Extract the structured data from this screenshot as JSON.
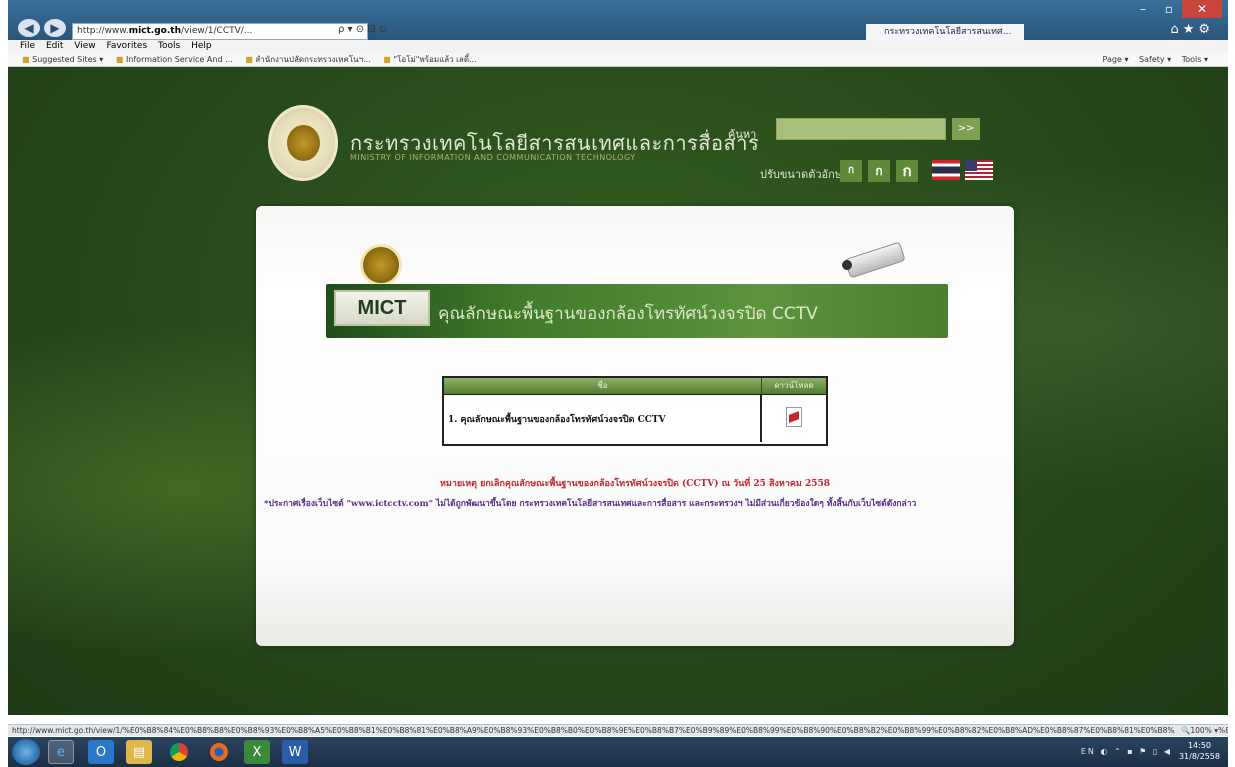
{
  "browser": {
    "address": {
      "prefix": "http://www.",
      "domain": "mict.go.th",
      "path": "/view/1/CCTV/..."
    },
    "tabs": [
      {
        "label": "",
        "active": false
      },
      {
        "label": "",
        "active": false
      },
      {
        "label": "กระทรวงเทคโนโลยีสารสนเทศ...",
        "active": true
      }
    ],
    "menu": [
      "File",
      "Edit",
      "View",
      "Favorites",
      "Tools",
      "Help"
    ],
    "favorites": [
      "Suggested Sites ▾",
      "Information Service And ...",
      "สำนักงานปลัดกระทรวงเทคโนฯ...",
      "\"โอโม่\"พร้อมแล้ว เลดี้..."
    ],
    "command_bar": [
      "Page ▾",
      "Safety ▾",
      "Tools ▾"
    ]
  },
  "site": {
    "title": "กระทรวงเทคโนโลยีสารสนเทศและการสื่อสาร",
    "subtitle": "MINISTRY OF INFORMATION AND COMMUNICATION TECHNOLOGY",
    "search_label": "ค้นหา",
    "search_button": ">>",
    "font_size_label": "ปรับขนาดตัวอักษร",
    "font_buttons": [
      "ก",
      "ก",
      "ก"
    ]
  },
  "banner": {
    "logo_text": "MICT",
    "title": "คุณลักษณะพื้นฐานของกล้องโทรทัศน์วงจรปิด CCTV"
  },
  "table": {
    "header_name": "ชื่อ",
    "header_file": "ดาวน์โหลด",
    "rows": [
      {
        "name": "1. คุณลักษณะพื้นฐานของกล้องโทรทัศน์วงจรปิด CCTV"
      }
    ]
  },
  "notice": "หมายเหตุ ยกเลิกคุณลักษณะพื้นฐานของกล้องโทรทัศน์วงจรปิด (CCTV) ณ วันที่ 25 สิงหาคม 2558",
  "disclaimer": "*ประกาศเรื่องเว็บไซต์ \"www.ictcctv.com\" ไม่ได้ถูกพัฒนาขึ้นโดย กระทรวงเทคโนโลยีสารสนเทศและการสื่อสาร และกระทรวงฯ ไม่มีส่วนเกี่ยวข้องใดๆ ทั้งสิ้นกับเว็บไซต์ดังกล่าว",
  "status": {
    "url": "http://www.mict.go.th/view/1/%E0%B8%84%E0%B8%B8%E0%B8%93%E0%B8%A5%E0%B8%B1%E0%B8%81%E0%B8%A9%E0%B8%93%E0%B8%B0%E0%B8%9E%E0%B8%B7%E0%B9%89%E0%B8%99%E0%B8%90%E0%B8%B2%E0%B8%99%E0%B8%82%E0%B8%AD%E0%B8%87%E0%B8%81%E0%B8%A5%E0%B9%89%E0%B8%AD%E0%B8%87",
    "zoom": "100%"
  },
  "taskbar": {
    "clock_time": "14:50",
    "clock_date": "31/8/2558"
  },
  "colors": {
    "page_bg": "#25461a",
    "banner_green": "#4a7f30",
    "notice_red": "#c1272d",
    "disclaimer_purple": "#5a2a8a"
  }
}
